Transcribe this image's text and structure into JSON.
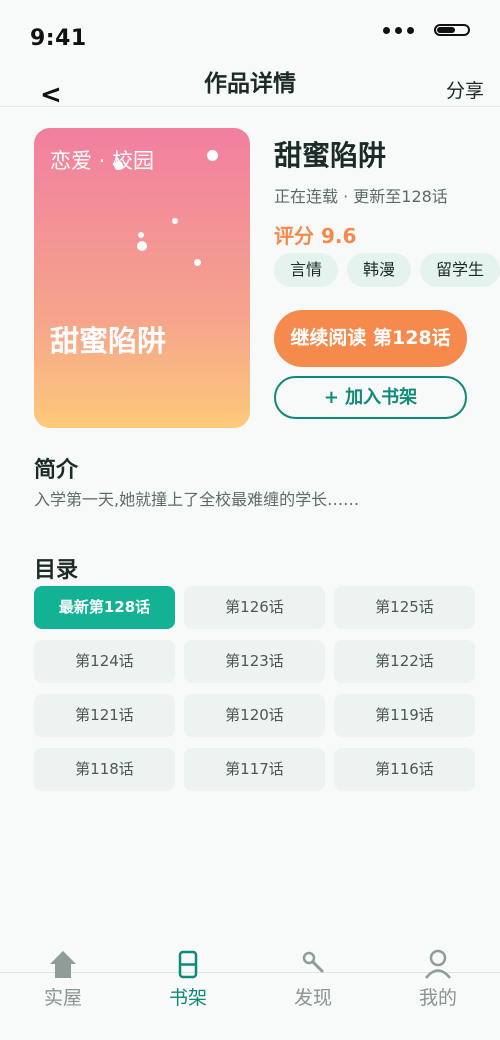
{
  "status_bar": {
    "time": "9:41"
  },
  "nav": {
    "back": "<",
    "title": "作品详情",
    "share": "分享"
  },
  "cover": {
    "tag": "恋爱 · 校园",
    "title": "甜蜜陷阱"
  },
  "book": {
    "title": "甜蜜陷阱",
    "status": "正在连载 · 更新至128话",
    "rating": "评分 9.6",
    "tags": [
      "言情",
      "韩漫",
      "留学生"
    ]
  },
  "actions": {
    "continue": "继续阅读 第128话",
    "add_shelf": "+ 加入书架"
  },
  "intro": {
    "heading": "简介",
    "text": "入学第一天,她就撞上了全校最难缠的学长……"
  },
  "catalog": {
    "heading": "目录",
    "chapters": [
      "最新第128话",
      "第126话",
      "第125话",
      "第124话",
      "第123话",
      "第122话",
      "第121话",
      "第120话",
      "第119话",
      "第118话",
      "第117话",
      "第116话"
    ]
  },
  "tabs": [
    "实屋",
    "书架",
    "发现",
    "我的"
  ],
  "colors": {
    "accent": "#0f8a78",
    "chapter_active": "#14b294",
    "orange": "#f58a4c"
  }
}
